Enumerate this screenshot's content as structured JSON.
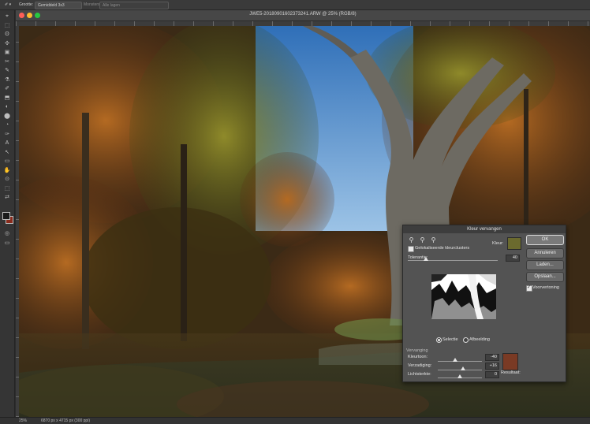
{
  "options_bar": {
    "sample_label": "Grootte:",
    "sample_value": "Gemiddeld 3x3",
    "field_1": "Monsters:",
    "field_2": "Alle lagen"
  },
  "window": {
    "title": "JWE5-20180901602373241.ARW @ 25% (RGB/8)",
    "traffic_colors": [
      "#ff5f57",
      "#febc2e",
      "#28c840"
    ]
  },
  "tools": [
    "⌖",
    "⬚",
    "ʘ",
    "✣",
    "▣",
    "✂",
    "✎",
    "⚗",
    "✐",
    "⬒",
    "◐",
    "⬤",
    "◔",
    "✑",
    "A",
    "↖",
    "▭",
    "✋",
    "⊙",
    "⬚",
    "⇄"
  ],
  "status": {
    "zoom": "25%",
    "doc_info": "6870 px x 4715 px (300 ppi)"
  },
  "dialog": {
    "title": "Kleur vervangen",
    "eyedroppers": [
      "eyedropper-icon",
      "eyedropper-plus-icon",
      "eyedropper-minus-icon"
    ],
    "localized_clusters": "Gelokaliseerde kleurclusters",
    "color_label": "Kleur:",
    "color_swatch": "#6b6a2e",
    "fuzziness_label": "Tolerantie:",
    "fuzziness_value": "40",
    "fuzziness_fraction": 0.2,
    "view_selection": "Selectie",
    "view_image": "Afbeelding",
    "replacement_title": "Vervanging",
    "hue_label": "Kleurtoon:",
    "hue_value": "-40",
    "hue_fraction": 0.39,
    "saturation_label": "Verzadiging:",
    "saturation_value": "+16",
    "saturation_fraction": 0.58,
    "lightness_label": "Lichtsterkte:",
    "lightness_value": "0",
    "lightness_fraction": 0.5,
    "result_label": "Resultaat:",
    "result_swatch": "#7a3a24",
    "ok": "OK",
    "cancel": "Annuleren",
    "load": "Laden...",
    "save": "Opslaan...",
    "preview": "Voorvertoning"
  }
}
